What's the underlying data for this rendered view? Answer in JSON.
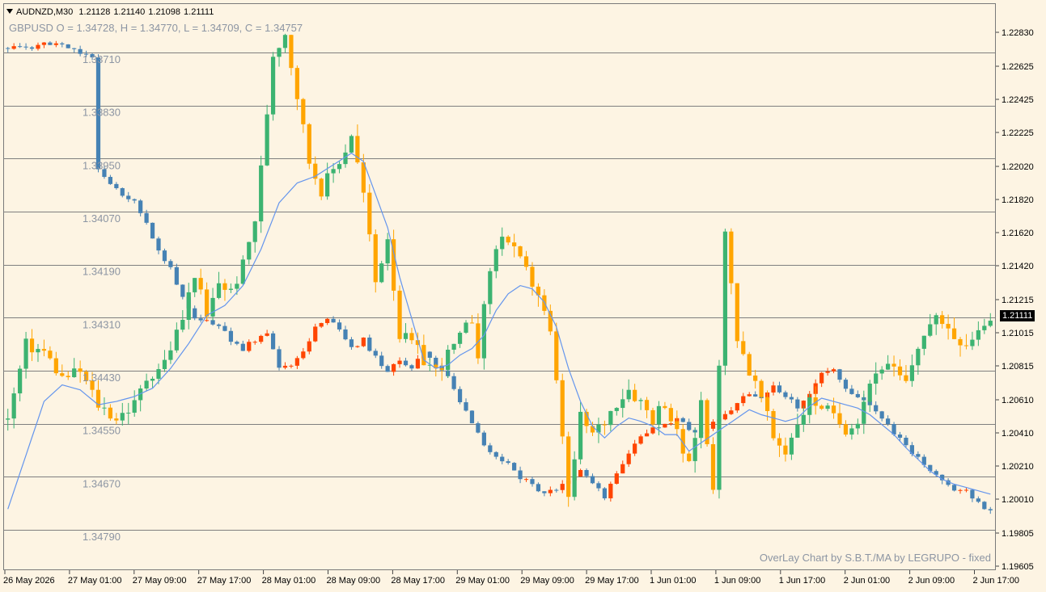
{
  "header": {
    "symbol_timeframe": "AUDNZD,M30",
    "open": "1.21128",
    "high": "1.21140",
    "low": "1.21098",
    "close": "1.21111"
  },
  "overlay": {
    "symbol": "GBPUSD",
    "o_label": "O = 1.34728,",
    "h_label": "H = 1.34770,",
    "l_label": "L = 1.34709,",
    "c_label": "C = 1.34757",
    "credit": "OverLay Chart by S.B.T./MA by LEGRUPO - fixed"
  },
  "current_price_label": "1.21111",
  "colors": {
    "background": "#fdf4e3",
    "bull_main": "#3cb371",
    "bear_main": "#ffa500",
    "bull_overlay": "#4682b4",
    "bear_overlay": "#ff4500",
    "ma_line": "#6495ed",
    "grid_line": "#7f7f7f",
    "overlay_label": "#8c95a3"
  },
  "chart_data": {
    "type": "candlestick",
    "main_series": {
      "name": "AUDNZD,M30",
      "y_axis_ticks": [
        "1.22830",
        "1.22625",
        "1.22425",
        "1.22225",
        "1.22020",
        "1.21820",
        "1.21620",
        "1.21420",
        "1.21215",
        "1.21015",
        "1.20815",
        "1.20610",
        "1.20410",
        "1.20210",
        "1.20010",
        "1.19805",
        "1.19605"
      ],
      "ylim": [
        1.19605,
        1.2295
      ],
      "last_price": 1.21111,
      "close_path": [
        [
          0,
          1.2049
        ],
        [
          3,
          1.2094
        ],
        [
          6,
          1.209
        ],
        [
          9,
          1.2074
        ],
        [
          12,
          1.2078
        ],
        [
          15,
          1.2058
        ],
        [
          18,
          1.205
        ],
        [
          21,
          1.2058
        ],
        [
          23,
          1.2074
        ],
        [
          26,
          1.2084
        ],
        [
          29,
          1.211
        ],
        [
          31,
          1.2138
        ],
        [
          33,
          1.211
        ],
        [
          35,
          1.2132
        ],
        [
          37,
          1.2126
        ],
        [
          39,
          1.2142
        ],
        [
          41,
          1.217
        ],
        [
          42,
          1.22
        ],
        [
          44,
          1.227
        ],
        [
          46,
          1.2283
        ],
        [
          48,
          1.2245
        ],
        [
          50,
          1.2205
        ],
        [
          52,
          1.2188
        ],
        [
          54,
          1.22
        ],
        [
          56,
          1.2212
        ],
        [
          57,
          1.2222
        ],
        [
          59,
          1.2185
        ],
        [
          61,
          1.2132
        ],
        [
          63,
          1.216
        ],
        [
          65,
          1.21
        ],
        [
          67,
          1.2095
        ],
        [
          69,
          1.2085
        ],
        [
          71,
          1.2078
        ],
        [
          73,
          1.2088
        ],
        [
          75,
          1.2098
        ],
        [
          77,
          1.211
        ],
        [
          78,
          1.209
        ],
        [
          80,
          1.214
        ],
        [
          82,
          1.2162
        ],
        [
          84,
          1.215
        ],
        [
          86,
          1.2138
        ],
        [
          88,
          1.2125
        ],
        [
          90,
          1.21
        ],
        [
          92,
          1.204
        ],
        [
          93,
          1.2
        ],
        [
          95,
          1.205
        ],
        [
          97,
          1.204
        ],
        [
          99,
          1.2048
        ],
        [
          101,
          1.206
        ],
        [
          103,
          1.2068
        ],
        [
          105,
          1.206
        ],
        [
          107,
          1.205
        ],
        [
          109,
          1.206
        ],
        [
          111,
          1.204
        ],
        [
          113,
          1.202
        ],
        [
          115,
          1.206
        ],
        [
          117,
          1.201
        ],
        [
          119,
          1.216
        ],
        [
          121,
          1.21
        ],
        [
          123,
          1.2078
        ],
        [
          125,
          1.2062
        ],
        [
          127,
          1.2038
        ],
        [
          129,
          1.203
        ],
        [
          131,
          1.2048
        ],
        [
          133,
          1.206
        ],
        [
          135,
          1.2058
        ],
        [
          137,
          1.205
        ],
        [
          139,
          1.2044
        ],
        [
          141,
          1.205
        ],
        [
          143,
          1.2072
        ],
        [
          145,
          1.2082
        ],
        [
          147,
          1.2078
        ],
        [
          149,
          1.207
        ],
        [
          151,
          1.2094
        ],
        [
          153,
          1.2106
        ],
        [
          155,
          1.211
        ],
        [
          157,
          1.21
        ],
        [
          159,
          1.2096
        ],
        [
          161,
          1.2104
        ],
        [
          163,
          1.2112
        ]
      ]
    },
    "overlay_series": {
      "name": "GBPUSD",
      "y_axis_ticks": [
        "1.33710",
        "1.33830",
        "1.33950",
        "1.34070",
        "1.34190",
        "1.34310",
        "1.34430",
        "1.34550",
        "1.34670",
        "1.34790"
      ],
      "inverted": true,
      "ylim": [
        1.3356,
        1.3486
      ],
      "close_path": [
        [
          0,
          1.337
        ],
        [
          3,
          1.337
        ],
        [
          6,
          1.3369
        ],
        [
          9,
          1.3369
        ],
        [
          12,
          1.3371
        ],
        [
          14,
          1.3372
        ],
        [
          15,
          1.3397
        ],
        [
          17,
          1.3401
        ],
        [
          19,
          1.3403
        ],
        [
          21,
          1.3405
        ],
        [
          23,
          1.341
        ],
        [
          25,
          1.3416
        ],
        [
          27,
          1.342
        ],
        [
          29,
          1.3426
        ],
        [
          31,
          1.3431
        ],
        [
          33,
          1.3432
        ],
        [
          35,
          1.3433
        ],
        [
          37,
          1.3436
        ],
        [
          39,
          1.3438
        ],
        [
          41,
          1.3436
        ],
        [
          43,
          1.3435
        ],
        [
          45,
          1.3442
        ],
        [
          47,
          1.3442
        ],
        [
          49,
          1.3439
        ],
        [
          51,
          1.3433
        ],
        [
          53,
          1.3431
        ],
        [
          55,
          1.3434
        ],
        [
          57,
          1.3438
        ],
        [
          59,
          1.3436
        ],
        [
          61,
          1.344
        ],
        [
          63,
          1.3443
        ],
        [
          65,
          1.3441
        ],
        [
          67,
          1.3442
        ],
        [
          69,
          1.3439
        ],
        [
          71,
          1.3442
        ],
        [
          73,
          1.3444
        ],
        [
          75,
          1.345
        ],
        [
          77,
          1.3455
        ],
        [
          79,
          1.346
        ],
        [
          81,
          1.3462
        ],
        [
          83,
          1.3464
        ],
        [
          85,
          1.3467
        ],
        [
          87,
          1.3469
        ],
        [
          89,
          1.3471
        ],
        [
          91,
          1.347
        ],
        [
          93,
          1.3468
        ],
        [
          95,
          1.3466
        ],
        [
          97,
          1.3468
        ],
        [
          99,
          1.3472
        ],
        [
          101,
          1.3466
        ],
        [
          103,
          1.3462
        ],
        [
          105,
          1.3458
        ],
        [
          107,
          1.3456
        ],
        [
          109,
          1.3455
        ],
        [
          111,
          1.3454
        ],
        [
          113,
          1.3456
        ],
        [
          115,
          1.3457
        ],
        [
          117,
          1.3455
        ],
        [
          119,
          1.3453
        ],
        [
          121,
          1.345
        ],
        [
          123,
          1.3448
        ],
        [
          125,
          1.3449
        ],
        [
          127,
          1.3446
        ],
        [
          129,
          1.3449
        ],
        [
          131,
          1.3451
        ],
        [
          133,
          1.3448
        ],
        [
          135,
          1.3444
        ],
        [
          137,
          1.3443
        ],
        [
          139,
          1.3447
        ],
        [
          141,
          1.3449
        ],
        [
          143,
          1.3451
        ],
        [
          145,
          1.3454
        ],
        [
          147,
          1.3457
        ],
        [
          149,
          1.346
        ],
        [
          151,
          1.3463
        ],
        [
          153,
          1.3466
        ],
        [
          155,
          1.3468
        ],
        [
          157,
          1.347
        ],
        [
          159,
          1.347
        ],
        [
          161,
          1.3473
        ],
        [
          163,
          1.3475
        ]
      ]
    },
    "moving_average_path": [
      [
        0,
        1.1995
      ],
      [
        6,
        1.206
      ],
      [
        9,
        1.207
      ],
      [
        12,
        1.2067
      ],
      [
        15,
        1.2058
      ],
      [
        18,
        1.206
      ],
      [
        21,
        1.2063
      ],
      [
        24,
        1.2068
      ],
      [
        27,
        1.208
      ],
      [
        30,
        1.2095
      ],
      [
        33,
        1.2112
      ],
      [
        36,
        1.2118
      ],
      [
        39,
        1.213
      ],
      [
        42,
        1.2152
      ],
      [
        45,
        1.218
      ],
      [
        48,
        1.2192
      ],
      [
        51,
        1.2196
      ],
      [
        54,
        1.2203
      ],
      [
        57,
        1.221
      ],
      [
        59,
        1.2205
      ],
      [
        61,
        1.2185
      ],
      [
        63,
        1.2165
      ],
      [
        65,
        1.2135
      ],
      [
        67,
        1.211
      ],
      [
        69,
        1.2085
      ],
      [
        71,
        1.208
      ],
      [
        73,
        1.2082
      ],
      [
        75,
        1.2088
      ],
      [
        77,
        1.2092
      ],
      [
        79,
        1.21
      ],
      [
        81,
        1.2115
      ],
      [
        83,
        1.2125
      ],
      [
        85,
        1.213
      ],
      [
        87,
        1.2128
      ],
      [
        89,
        1.212
      ],
      [
        91,
        1.2105
      ],
      [
        93,
        1.208
      ],
      [
        95,
        1.206
      ],
      [
        97,
        1.2045
      ],
      [
        99,
        1.2038
      ],
      [
        101,
        1.2045
      ],
      [
        103,
        1.205
      ],
      [
        105,
        1.2048
      ],
      [
        107,
        1.2045
      ],
      [
        109,
        1.204
      ],
      [
        111,
        1.204
      ],
      [
        113,
        1.203
      ],
      [
        115,
        1.2035
      ],
      [
        117,
        1.204
      ],
      [
        119,
        1.2045
      ],
      [
        121,
        1.205
      ],
      [
        123,
        1.2055
      ],
      [
        125,
        1.2052
      ],
      [
        127,
        1.205
      ],
      [
        129,
        1.2048
      ],
      [
        131,
        1.205
      ],
      [
        133,
        1.2057
      ],
      [
        135,
        1.2062
      ],
      [
        137,
        1.206
      ],
      [
        139,
        1.2058
      ],
      [
        141,
        1.2056
      ],
      [
        143,
        1.2052
      ],
      [
        145,
        1.2046
      ],
      [
        147,
        1.204
      ],
      [
        149,
        1.2032
      ],
      [
        151,
        1.2025
      ],
      [
        153,
        1.2018
      ],
      [
        155,
        1.2013
      ],
      [
        157,
        1.201
      ],
      [
        159,
        1.2008
      ],
      [
        161,
        1.2006
      ],
      [
        163,
        1.2004
      ]
    ],
    "x_axis_ticks": [
      "26 May 2026",
      "27 May 01:00",
      "27 May 09:00",
      "27 May 17:00",
      "28 May 01:00",
      "28 May 09:00",
      "28 May 17:00",
      "29 May 01:00",
      "29 May 09:00",
      "29 May 17:00",
      "1 Jun 01:00",
      "1 Jun 09:00",
      "1 Jun 17:00",
      "2 Jun 01:00",
      "2 Jun 09:00",
      "2 Jun 17:00"
    ],
    "grid": "horizontal lines at overlay price levels"
  }
}
